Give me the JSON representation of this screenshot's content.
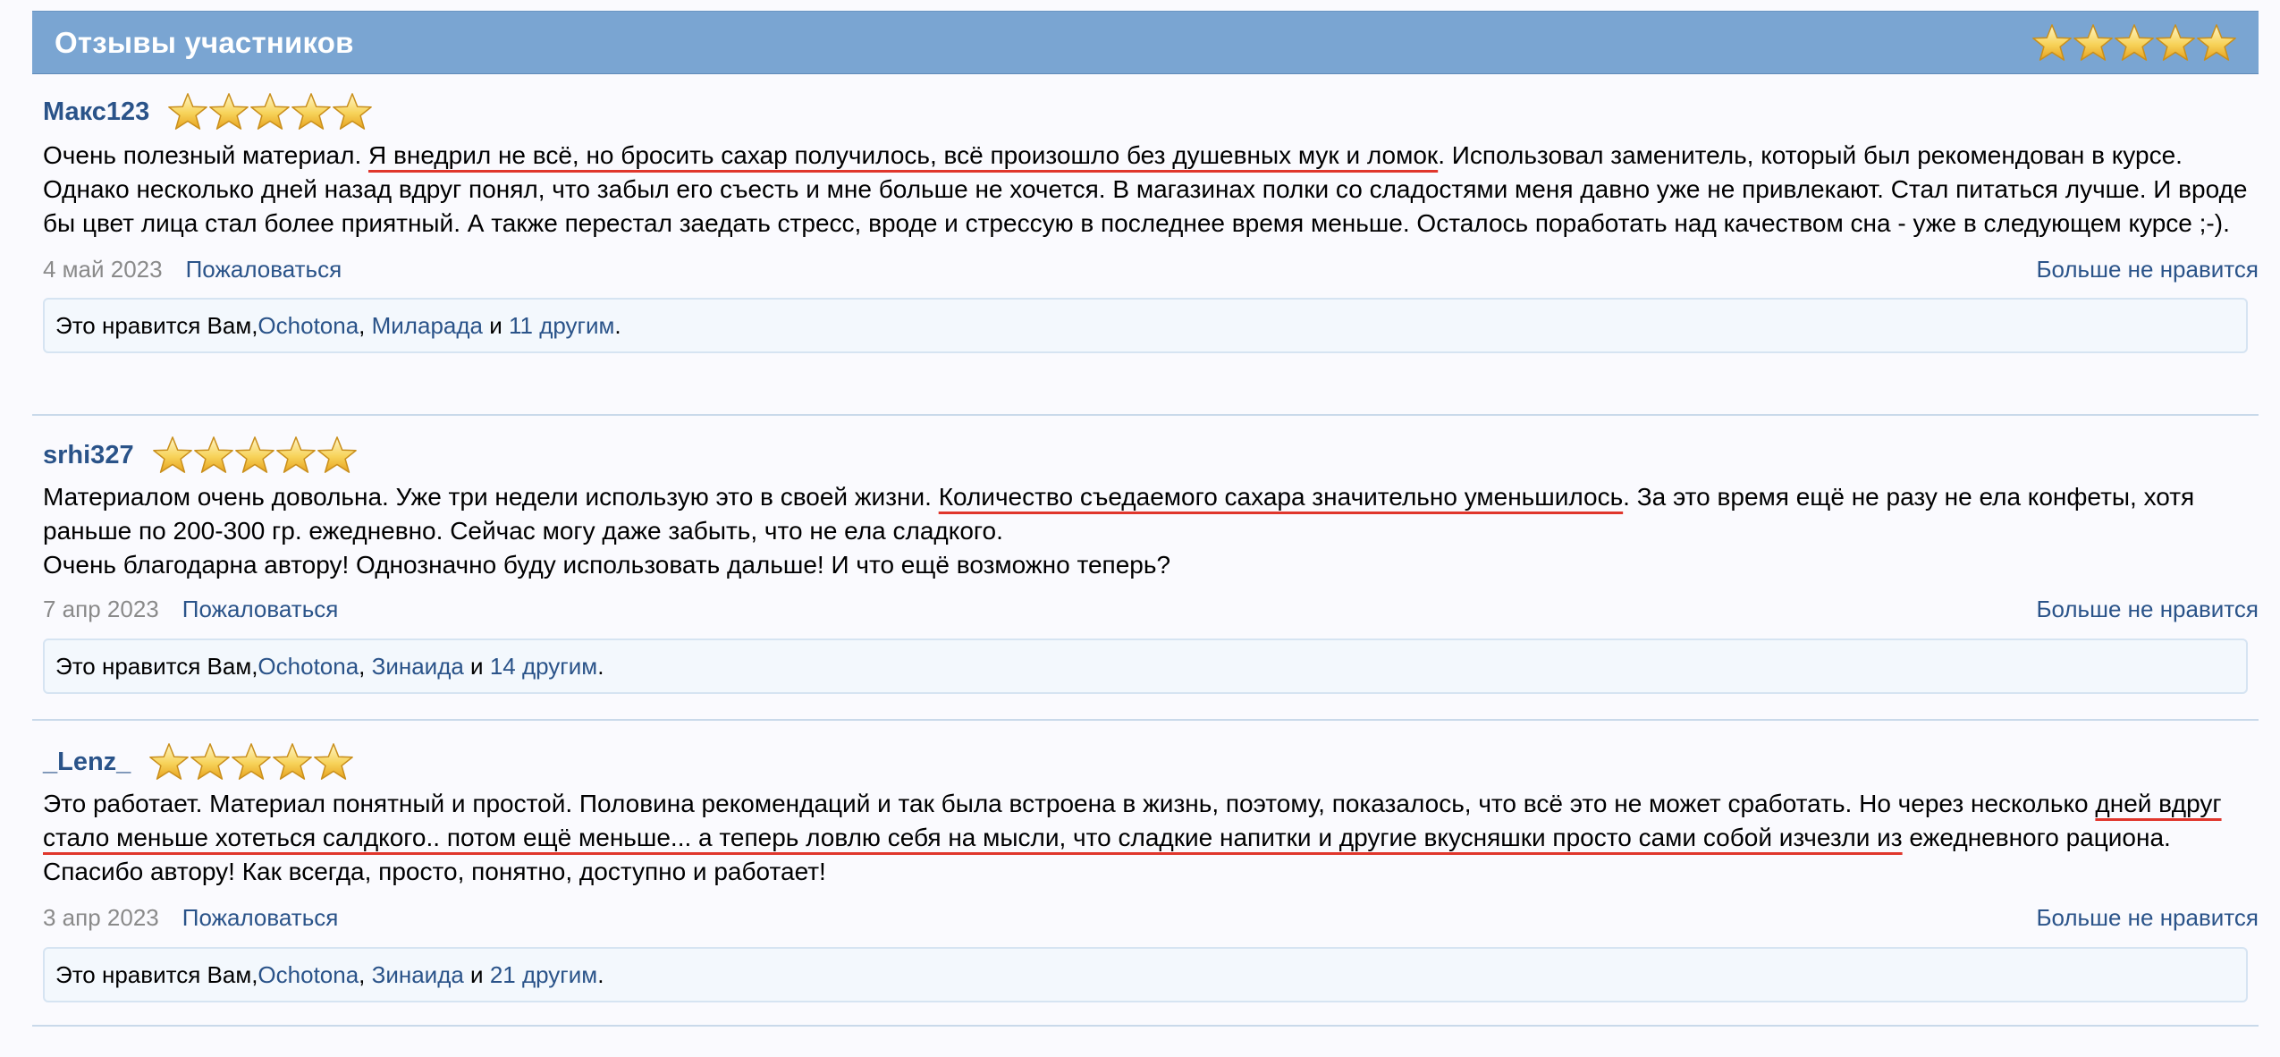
{
  "header": {
    "title": "Отзывы участников",
    "rating": 5
  },
  "reviews": [
    {
      "user": "Макс123",
      "rating": 5,
      "text_before": "Очень полезный материал. ",
      "text_highlight": "Я внедрил не всё, но бросить сахар получилось, всё произошло без душевных мук и ломок",
      "text_after": ". Использовал заменитель, который был рекомендован в курсе. Однако несколько дней назад вдруг понял, что забыл его съесть и мне больше не хочется. В магазинах полки со сладостями меня давно уже не привлекают. Стал питаться лучше. И вроде бы цвет лица стал более приятный. А также перестал заедать стресс, вроде и стрессую в последнее время меньше. Осталось поработать над качеством сна - уже в следующем курсе ;-).",
      "date": "4 май 2023",
      "report": "Пожаловаться",
      "unlike": "Больше не нравится",
      "likes": {
        "prefix": "Это нравится Вам, ",
        "u1": "Ochotona",
        "sep": ", ",
        "u2": "Милaрада",
        "and": " и ",
        "others": "11 другим",
        "end": "."
      }
    },
    {
      "user": "srhi327",
      "rating": 5,
      "text_before": "Материалом очень довольна. Уже три недели использую это в своей жизни. ",
      "text_highlight": "Количество съедаемого сахара значительно уменьшилось",
      "text_after": ". За это время ещё не разу не ела конфеты, хотя раньше по 200-300 гр. ежедневно. Сейчас могу даже забыть, что не ела сладкого.",
      "text_line2": "Очень благодарна автору! Однозначно буду использовать дальше! И что ещё возможно теперь?",
      "date": "7 апр 2023",
      "report": "Пожаловаться",
      "unlike": "Больше не нравится",
      "likes": {
        "prefix": "Это нравится Вам, ",
        "u1": "Ochotona",
        "sep": ", ",
        "u2": "Зинаида",
        "and": " и ",
        "others": "14 другим",
        "end": "."
      }
    },
    {
      "user": "_Lenz_",
      "rating": 5,
      "text_before": "Это работает. Материал понятный и простой. Половина рекомендаций и так была встроена в жизнь, поэтому, показалось, что всё это не может сработать. Но через несколько ",
      "text_highlight": "дней вдруг стало меньше хотеться салдкого.. потом ещё меньше... а теперь ловлю себя на мысли, что сладкие напитки и другие вкусняшки просто сами собой изчезли из",
      "text_after": " ежедневного рациона. Спасибо автору! Как всегда, просто, понятно, доступно и работает!",
      "date": "3 апр 2023",
      "report": "Пожаловаться",
      "unlike": "Больше не нравится",
      "likes": {
        "prefix": "Это нравится Вам, ",
        "u1": "Ochotona",
        "sep": ", ",
        "u2": "Зинаида",
        "and": " и ",
        "others": "21 другим",
        "end": "."
      }
    }
  ],
  "colors": {
    "header_bg": "#7aa5d2",
    "link": "#2a5389",
    "highlight_underline": "#e0362c",
    "star": "#f2b62a"
  },
  "icons": {
    "rating_star": "star-icon"
  }
}
